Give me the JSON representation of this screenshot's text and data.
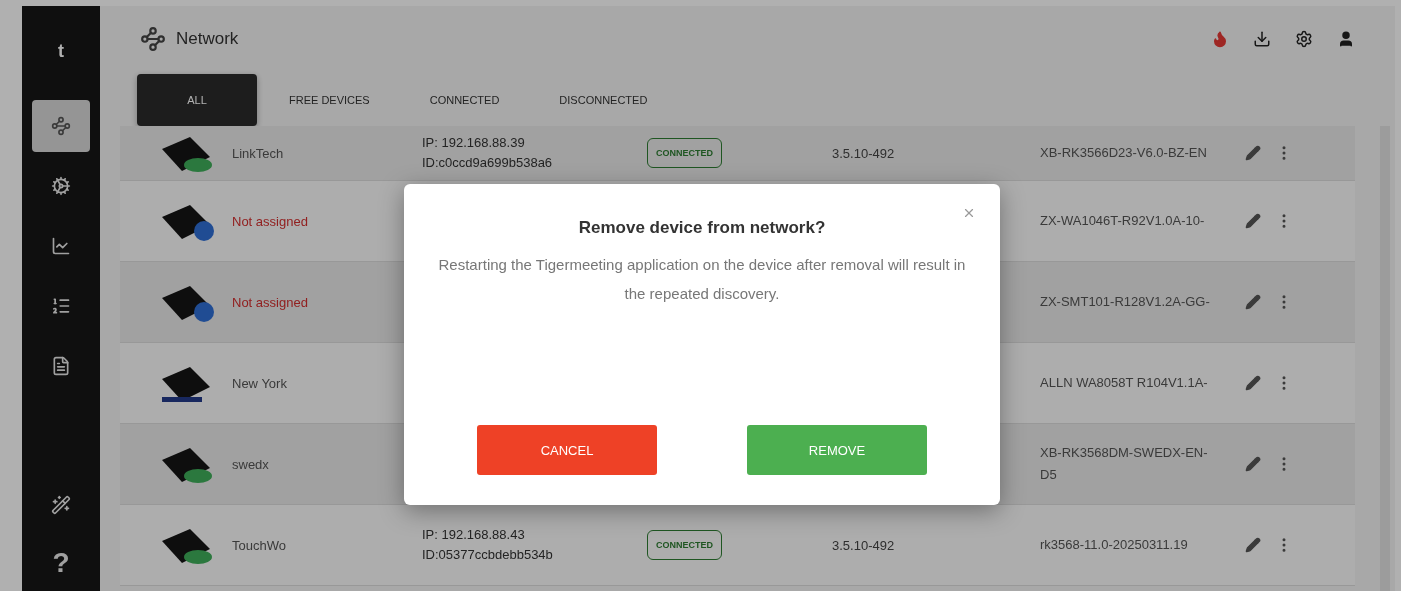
{
  "sidebar": {
    "logo": "t",
    "items": [
      {
        "selected": true
      },
      {
        "selected": false
      },
      {
        "selected": false
      },
      {
        "selected": false
      },
      {
        "selected": false
      }
    ],
    "help": "?"
  },
  "header": {
    "title": "Network"
  },
  "tabs": [
    {
      "label": "ALL",
      "selected": true
    },
    {
      "label": "FREE DEVICES",
      "selected": false
    },
    {
      "label": "CONNECTED",
      "selected": false
    },
    {
      "label": "DISCONNECTED",
      "selected": false
    }
  ],
  "devices": [
    {
      "kind": "stand",
      "name": "LinkTech",
      "assigned": true,
      "ip": "IP: 192.168.88.39",
      "id": "ID:c0ccd9a699b538a6",
      "status": "CONNECTED",
      "connected": true,
      "version": "3.5.10-492",
      "firmware": "XB-RK3566D23-V6.0-BZ-EN"
    },
    {
      "kind": "badge",
      "name": "Not assigned",
      "assigned": false,
      "firmware": "ZX-WA1046T-R92V1.0A-10-"
    },
    {
      "kind": "badge",
      "name": "Not assigned",
      "assigned": false,
      "firmware": "ZX-SMT101-R128V1.2A-GG-"
    },
    {
      "kind": "plain",
      "name": "New York",
      "assigned": true,
      "firmware": "ALLN WA8058T R104V1.1A-"
    },
    {
      "kind": "stand",
      "name": "swedx",
      "assigned": true,
      "firmware": "XB-RK3568DM-SWEDX-EN-D5"
    },
    {
      "kind": "stand",
      "name": "TouchWo",
      "assigned": true,
      "ip": "IP: 192.168.88.43",
      "id": "ID:05377ccbdebb534b",
      "status": "CONNECTED",
      "connected": true,
      "version": "3.5.10-492",
      "firmware": "rk3568-11.0-20250311.19"
    }
  ],
  "dialog": {
    "title": "Remove device from network?",
    "message": "Restarting the Tigermeeting application on the device after removal will result in the repeated discovery.",
    "buttons": [
      {
        "label": "CANCEL",
        "kind": "cancel"
      },
      {
        "label": "REMOVE",
        "kind": "confirm"
      }
    ]
  }
}
